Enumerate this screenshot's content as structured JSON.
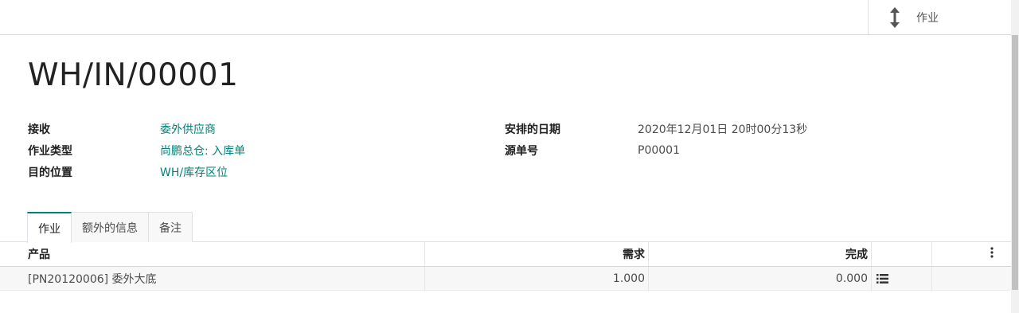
{
  "topbar": {
    "smart_button": {
      "label": "作业",
      "icon": "arrows-v-icon"
    }
  },
  "record": {
    "title": "WH/IN/00001"
  },
  "fields": {
    "left": [
      {
        "label": "接收",
        "value": "委外供应商",
        "link": true
      },
      {
        "label": "作业类型",
        "value": "尚鹏总仓: 入库单",
        "link": true
      },
      {
        "label": "目的位置",
        "value": "WH/库存区位",
        "link": true
      }
    ],
    "right": [
      {
        "label": "安排的日期",
        "value": "2020年12月01日 20时00分13秒",
        "link": false
      },
      {
        "label": "源单号",
        "value": "P00001",
        "link": false
      }
    ]
  },
  "tabs": [
    {
      "label": "作业",
      "active": true
    },
    {
      "label": "额外的信息",
      "active": false
    },
    {
      "label": "备注",
      "active": false
    }
  ],
  "table": {
    "headers": {
      "product": "产品",
      "demand": "需求",
      "done": "完成"
    },
    "rows": [
      {
        "product": "[PN20120006] 委外大底",
        "demand": "1.000",
        "done": "0.000"
      }
    ]
  },
  "colors": {
    "accent": "#00827a",
    "label": "#212121",
    "text": "#4c4c4c"
  }
}
